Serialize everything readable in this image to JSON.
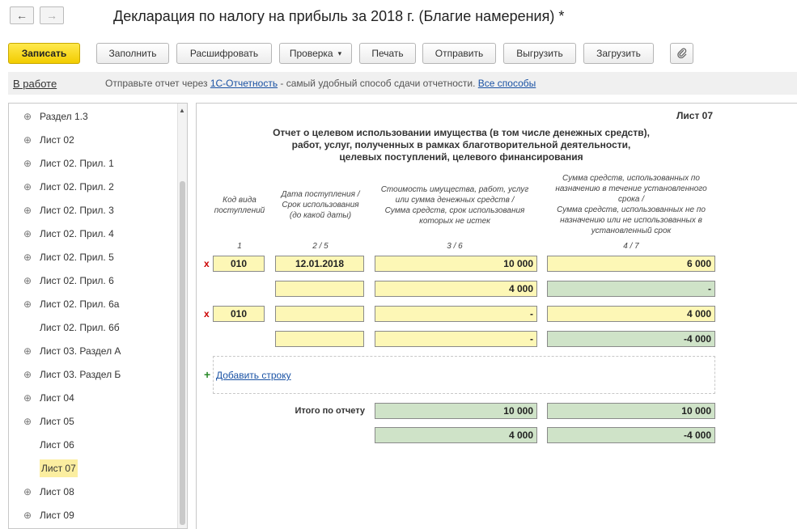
{
  "window": {
    "title": "Декларация по налогу на прибыль за 2018 г. (Благие намерения) *"
  },
  "nav": {
    "back_icon": "arrow-left-icon",
    "forward_icon": "arrow-right-icon",
    "back_glyph": "←",
    "forward_glyph": "→"
  },
  "toolbar": {
    "save": "Записать",
    "fill": "Заполнить",
    "decode": "Расшифровать",
    "check": "Проверка",
    "check_arrow": "▾",
    "print": "Печать",
    "send": "Отправить",
    "export": "Выгрузить",
    "import": "Загрузить",
    "attach_icon": "paperclip-icon"
  },
  "status": {
    "state": "В работе",
    "msg_prefix": "Отправьте отчет через ",
    "msg_link": "1С-Отчетность",
    "msg_suffix": " - самый удобный способ сдачи отчетности. ",
    "all_methods": "Все способы"
  },
  "tree": {
    "items": [
      {
        "label": "Раздел 1.3",
        "expandable": true,
        "selected": false
      },
      {
        "label": "Лист 02",
        "expandable": true,
        "selected": false
      },
      {
        "label": "Лист 02. Прил. 1",
        "expandable": true,
        "selected": false
      },
      {
        "label": "Лист 02. Прил. 2",
        "expandable": true,
        "selected": false
      },
      {
        "label": "Лист 02. Прил. 3",
        "expandable": true,
        "selected": false
      },
      {
        "label": "Лист 02. Прил. 4",
        "expandable": true,
        "selected": false
      },
      {
        "label": "Лист 02. Прил. 5",
        "expandable": true,
        "selected": false
      },
      {
        "label": "Лист 02. Прил. 6",
        "expandable": true,
        "selected": false
      },
      {
        "label": "Лист 02. Прил. 6а",
        "expandable": true,
        "selected": false
      },
      {
        "label": "Лист 02. Прил. 6б",
        "expandable": false,
        "selected": false
      },
      {
        "label": "Лист 03. Раздел А",
        "expandable": true,
        "selected": false
      },
      {
        "label": "Лист 03. Раздел Б",
        "expandable": true,
        "selected": false
      },
      {
        "label": "Лист 04",
        "expandable": true,
        "selected": false
      },
      {
        "label": "Лист 05",
        "expandable": true,
        "selected": false
      },
      {
        "label": "Лист 06",
        "expandable": false,
        "selected": false
      },
      {
        "label": "Лист 07",
        "expandable": false,
        "selected": true
      },
      {
        "label": "Лист 08",
        "expandable": true,
        "selected": false
      },
      {
        "label": "Лист 09",
        "expandable": true,
        "selected": false
      }
    ],
    "expand_glyph": "⊕"
  },
  "form": {
    "sheet": "Лист 07",
    "heading": "Отчет о целевом использовании имущества (в том числе денежных средств),\nработ, услуг, полученных в рамках благотворительной деятельности,\nцелевых поступлений, целевого финансирования",
    "columns": [
      {
        "header": "Код вида\nпоступлений",
        "num": "1"
      },
      {
        "header": "Дата поступления /\nСрок использования\n(до какой даты)",
        "num": "2 / 5"
      },
      {
        "header": "Стоимость имущества, работ, услуг\nили сумма денежных средств /\nСумма средств, срок использования\nкоторых не истек",
        "num": "3 / 6"
      },
      {
        "header": "Сумма средств, использованных по\nназначению в течение установленного\nсрока /\nСумма средств, использованных не по\nназначению или не использованных в\nустановленный срок",
        "num": "4 / 7"
      }
    ],
    "delete_mark": "x",
    "rows": [
      {
        "code": "010",
        "date": "12.01.2018",
        "amount": "10 000",
        "used": "6 000"
      },
      {
        "code": "",
        "date": "",
        "amount": "4 000",
        "used": "-"
      },
      {
        "code": "010",
        "date": "",
        "amount": "-",
        "used": "4 000"
      },
      {
        "code": "",
        "date": "",
        "amount": "-",
        "used": "-4 000"
      }
    ],
    "add_row_icon": "plus-icon",
    "add_row_glyph": "+",
    "add_row": "Добавить строку",
    "total_label": "Итого по отчету",
    "totals": [
      {
        "amount": "10 000",
        "used": "10 000"
      },
      {
        "amount": "4 000",
        "used": "-4 000"
      }
    ]
  },
  "colors": {
    "accent": "#f2cc00",
    "cell_yellow": "#fdf7b6",
    "cell_green": "#cfe3c8",
    "link": "#1a52a4"
  }
}
